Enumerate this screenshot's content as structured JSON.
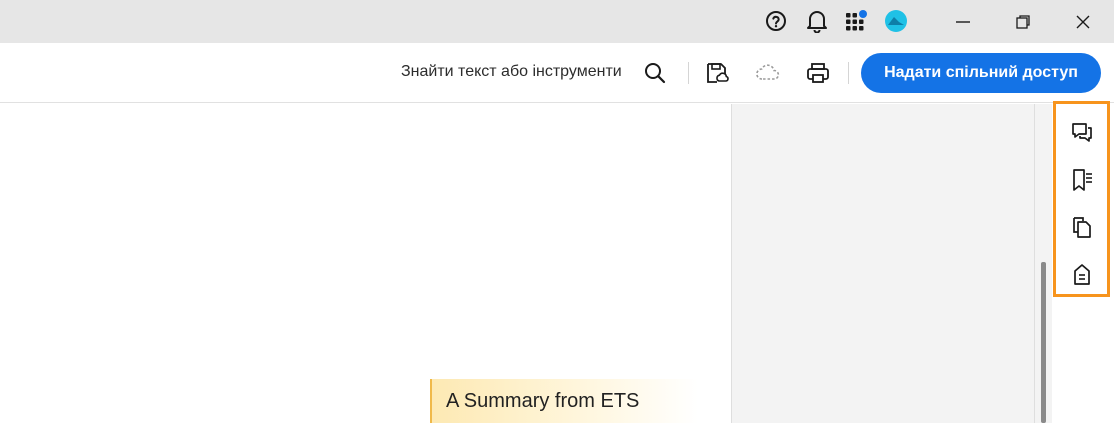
{
  "titlebar": {
    "icons": [
      "help-icon",
      "bell-icon",
      "apps-grid-icon",
      "profile-avatar"
    ],
    "window_controls": [
      "minimize",
      "restore",
      "close"
    ],
    "notification_dot_color": "#1473e6",
    "avatar_color": "#1fc1e6"
  },
  "toolbar": {
    "search_label": "Знайти текст або інструменти",
    "share_label": "Надати спільний доступ",
    "share_color": "#1473e6",
    "icons": [
      "search-icon",
      "save-icon",
      "cloud-icon",
      "print-icon"
    ]
  },
  "document": {
    "summary_heading": "A Summary from ETS"
  },
  "right_rail": {
    "highlight_color": "#f7941d",
    "icons": [
      "comment-icon",
      "bookmarks-icon",
      "pages-icon",
      "document-properties-icon"
    ]
  }
}
